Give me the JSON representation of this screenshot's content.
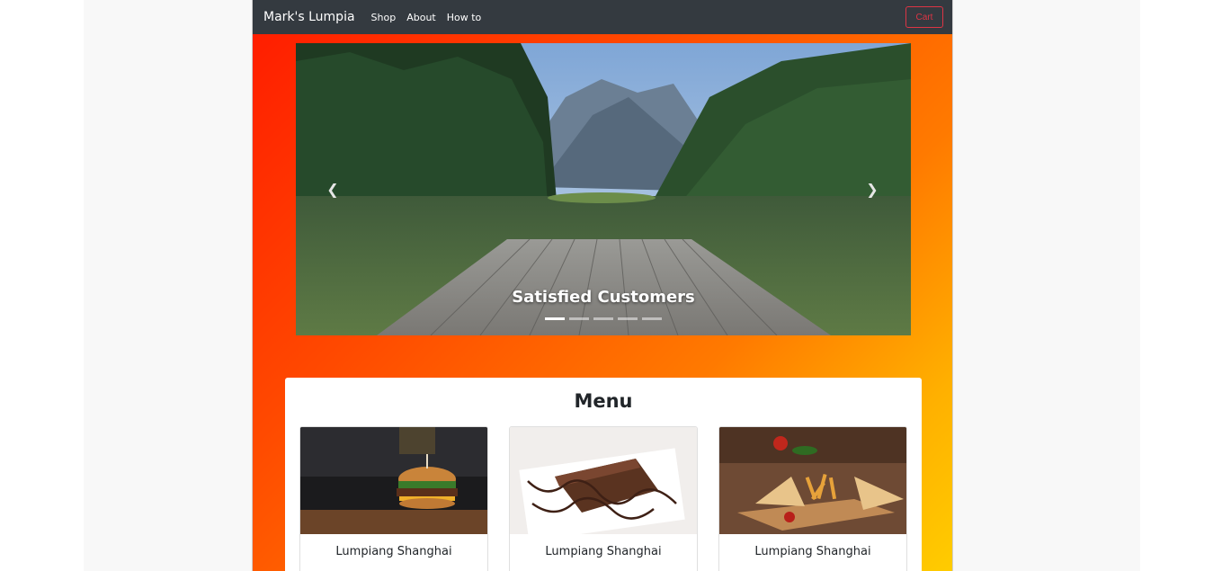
{
  "navbar": {
    "brand": "Mark's Lumpia",
    "links": [
      "Shop",
      "About",
      "How to"
    ],
    "cart_label": "Cart"
  },
  "carousel": {
    "caption": "Satisfied Customers",
    "prev_icon": "chevron-left-icon",
    "next_icon": "chevron-right-icon",
    "slide_count": 5,
    "active_index": 0
  },
  "menu": {
    "title": "Menu",
    "items": [
      {
        "name": "Lumpiang Shanghai",
        "image": "burger"
      },
      {
        "name": "Lumpiang Shanghai",
        "image": "chocolate-brownie"
      },
      {
        "name": "Lumpiang Shanghai",
        "image": "sandwich-fries"
      }
    ]
  },
  "colors": {
    "navbar_bg": "#343a40",
    "cart_outline": "#dc3545",
    "gradient_start": "#ff1a00",
    "gradient_end": "#ffcc00"
  }
}
